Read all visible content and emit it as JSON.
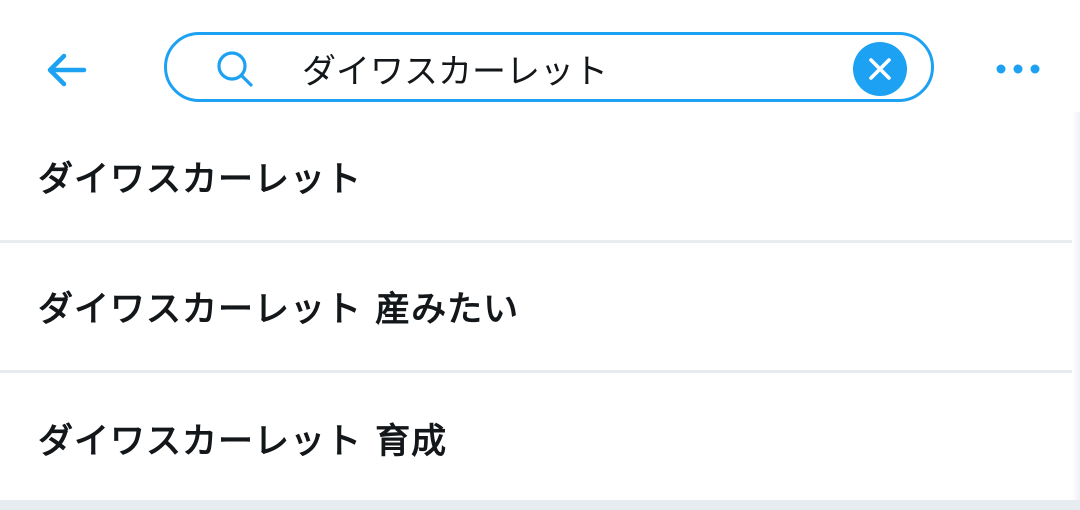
{
  "search": {
    "query": "ダイワスカーレット"
  },
  "icons": {
    "back": "arrow-left-icon",
    "search": "search-icon",
    "clear": "close-icon",
    "more": "more-horizontal-icon"
  },
  "colors": {
    "accent": "#1da1f2",
    "text": "#14171a",
    "divider": "#e6ecf0"
  },
  "suggestions": [
    {
      "label": "ダイワスカーレット"
    },
    {
      "label": "ダイワスカーレット 産みたい"
    },
    {
      "label": "ダイワスカーレット 育成"
    }
  ]
}
